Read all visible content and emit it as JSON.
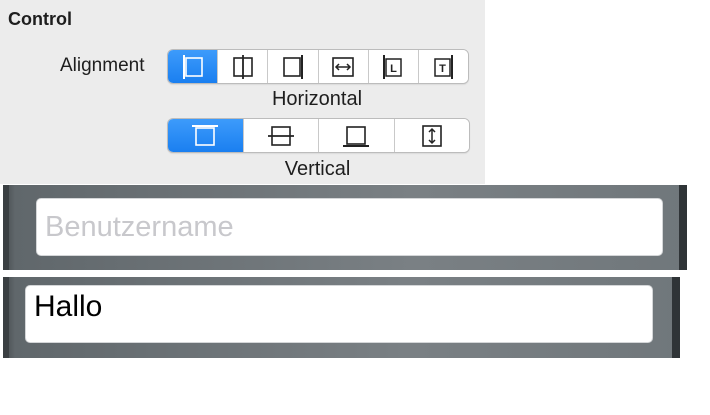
{
  "control_panel": {
    "title": "Control",
    "alignment_label": "Alignment",
    "horizontal": {
      "caption": "Horizontal",
      "selected_index": 0,
      "options": [
        {
          "icon": "align-left-edge-icon"
        },
        {
          "icon": "align-center-icon"
        },
        {
          "icon": "align-right-edge-icon"
        },
        {
          "icon": "fill-horizontal-icon"
        },
        {
          "icon": "align-leading-icon",
          "glyph": "L"
        },
        {
          "icon": "align-trailing-icon",
          "glyph": "T"
        }
      ]
    },
    "vertical": {
      "caption": "Vertical",
      "selected_index": 0,
      "options": [
        {
          "icon": "align-top-edge-icon"
        },
        {
          "icon": "align-middle-icon"
        },
        {
          "icon": "align-bottom-edge-icon"
        },
        {
          "icon": "fill-vertical-icon"
        }
      ]
    }
  },
  "text_fields": {
    "username": {
      "value": "",
      "placeholder": "Benutzername"
    },
    "greeting": {
      "value": "Hallo",
      "placeholder": ""
    }
  },
  "colors": {
    "accent": "#1a7ff0",
    "panel_bg": "#ececec",
    "bar_bg": "#7a8084"
  }
}
